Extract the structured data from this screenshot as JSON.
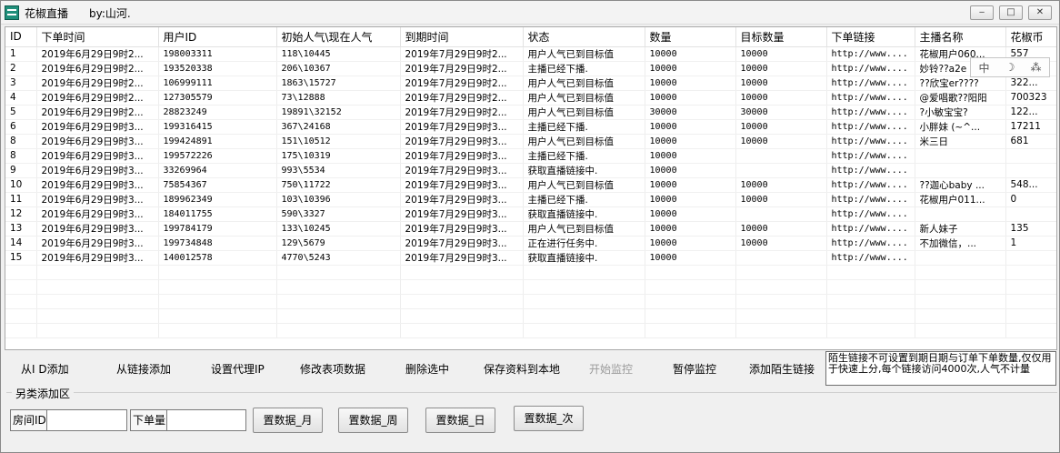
{
  "window": {
    "title": "花椒直播",
    "author": "by:山河.",
    "controls": {
      "minimize": "‒",
      "maximize": "□",
      "close": "✕"
    }
  },
  "table": {
    "columns": [
      "ID",
      "下单时间",
      "用户ID",
      "初始人气\\现在人气",
      "到期时间",
      "状态",
      "数量",
      "目标数量",
      "下单链接",
      "主播名称",
      "花椒币"
    ],
    "rows": [
      [
        "1",
        "2019年6月29日9时2...",
        "198003311",
        "118\\10445",
        "2019年7月29日9时2...",
        "用户人气已到目标值",
        "10000",
        "10000",
        "http://www....",
        "花椒用户060...",
        "557"
      ],
      [
        "2",
        "2019年6月29日9时2...",
        "193520338",
        "206\\10367",
        "2019年7月29日9时2...",
        "主播已经下播.",
        "10000",
        "10000",
        "http://www....",
        "妙铃??a2e",
        ""
      ],
      [
        "3",
        "2019年6月29日9时2...",
        "106999111",
        "1863\\15727",
        "2019年7月29日9时2...",
        "用户人气已到目标值",
        "10000",
        "10000",
        "http://www....",
        "??欣宝er????",
        "322..."
      ],
      [
        "4",
        "2019年6月29日9时2...",
        "127305579",
        "73\\12888",
        "2019年7月29日9时2...",
        "用户人气已到目标值",
        "10000",
        "10000",
        "http://www....",
        "@爱唱歌??阳阳",
        "700323"
      ],
      [
        "5",
        "2019年6月29日9时2...",
        "28823249",
        "19891\\32152",
        "2019年7月29日9时2...",
        "用户人气已到目标值",
        "30000",
        "30000",
        "http://www....",
        "?小敏宝宝?",
        "122..."
      ],
      [
        "6",
        "2019年6月29日9时3...",
        "199316415",
        "367\\24168",
        "2019年7月29日9时3...",
        "主播已经下播.",
        "10000",
        "10000",
        "http://www....",
        "小胖妹 (~^...",
        "17211"
      ],
      [
        "8",
        "2019年6月29日9时3...",
        "199424891",
        "151\\10512",
        "2019年7月29日9时3...",
        "用户人气已到目标值",
        "10000",
        "10000",
        "http://www....",
        "米三日",
        "681"
      ],
      [
        "8",
        "2019年6月29日9时3...",
        "199572226",
        "175\\10319",
        "2019年7月29日9时3...",
        "主播已经下播.",
        "10000",
        "",
        "http://www....",
        "",
        ""
      ],
      [
        "9",
        "2019年6月29日9时3...",
        "33269964",
        "993\\5534",
        "2019年7月29日9时3...",
        "获取直播链接中.",
        "10000",
        "",
        "http://www....",
        "",
        ""
      ],
      [
        "10",
        "2019年6月29日9时3...",
        "75854367",
        "750\\11722",
        "2019年7月29日9时3...",
        "用户人气已到目标值",
        "10000",
        "10000",
        "http://www....",
        "??迦心baby ...",
        "548..."
      ],
      [
        "11",
        "2019年6月29日9时3...",
        "189962349",
        "103\\10396",
        "2019年7月29日9时3...",
        "主播已经下播.",
        "10000",
        "10000",
        "http://www....",
        "花椒用户011...",
        "0"
      ],
      [
        "12",
        "2019年6月29日9时3...",
        "184011755",
        "590\\3327",
        "2019年7月29日9时3...",
        "获取直播链接中.",
        "10000",
        "",
        "http://www....",
        "",
        ""
      ],
      [
        "13",
        "2019年6月29日9时3...",
        "199784179",
        "133\\10245",
        "2019年7月29日9时3...",
        "用户人气已到目标值",
        "10000",
        "10000",
        "http://www....",
        "新人妹子",
        "135"
      ],
      [
        "14",
        "2019年6月29日9时3...",
        "199734848",
        "129\\5679",
        "2019年7月29日9时3...",
        "正在进行任务中.",
        "10000",
        "10000",
        "http://www....",
        "不加微信，...",
        "1"
      ],
      [
        "15",
        "2019年6月29日9时3...",
        "140012578",
        "4770\\5243",
        "2019年7月29日9时3...",
        "获取直播链接中.",
        "10000",
        "",
        "http://www....",
        "",
        ""
      ]
    ]
  },
  "ime": {
    "lang": "中",
    "moon": "☽",
    "mode": "⁂"
  },
  "toolbar": {
    "add_by_id": "从I  D添加",
    "add_by_link": "从链接添加",
    "set_proxy": "设置代理IP",
    "edit_data": "修改表项数据",
    "delete_selected": "删除选中",
    "save_local": "保存资料到本地",
    "start_monitor": "开始监控",
    "pause_monitor": "暂停监控",
    "add_stranger_link": "添加陌生链接"
  },
  "note": "陌生链接不可设置到期日期与订单下单数量,仅仅用于快速上分,每个链接访问4000次,人气不计量",
  "alt_add": {
    "group_label": "另类添加区",
    "room_id_label": "房间ID",
    "order_qty_label": "下单量",
    "room_id_value": "",
    "order_qty_value": "",
    "btn_month": "置数据_月",
    "btn_week": "置数据_周",
    "btn_day": "置数据_日",
    "btn_times": "置数据_次"
  }
}
